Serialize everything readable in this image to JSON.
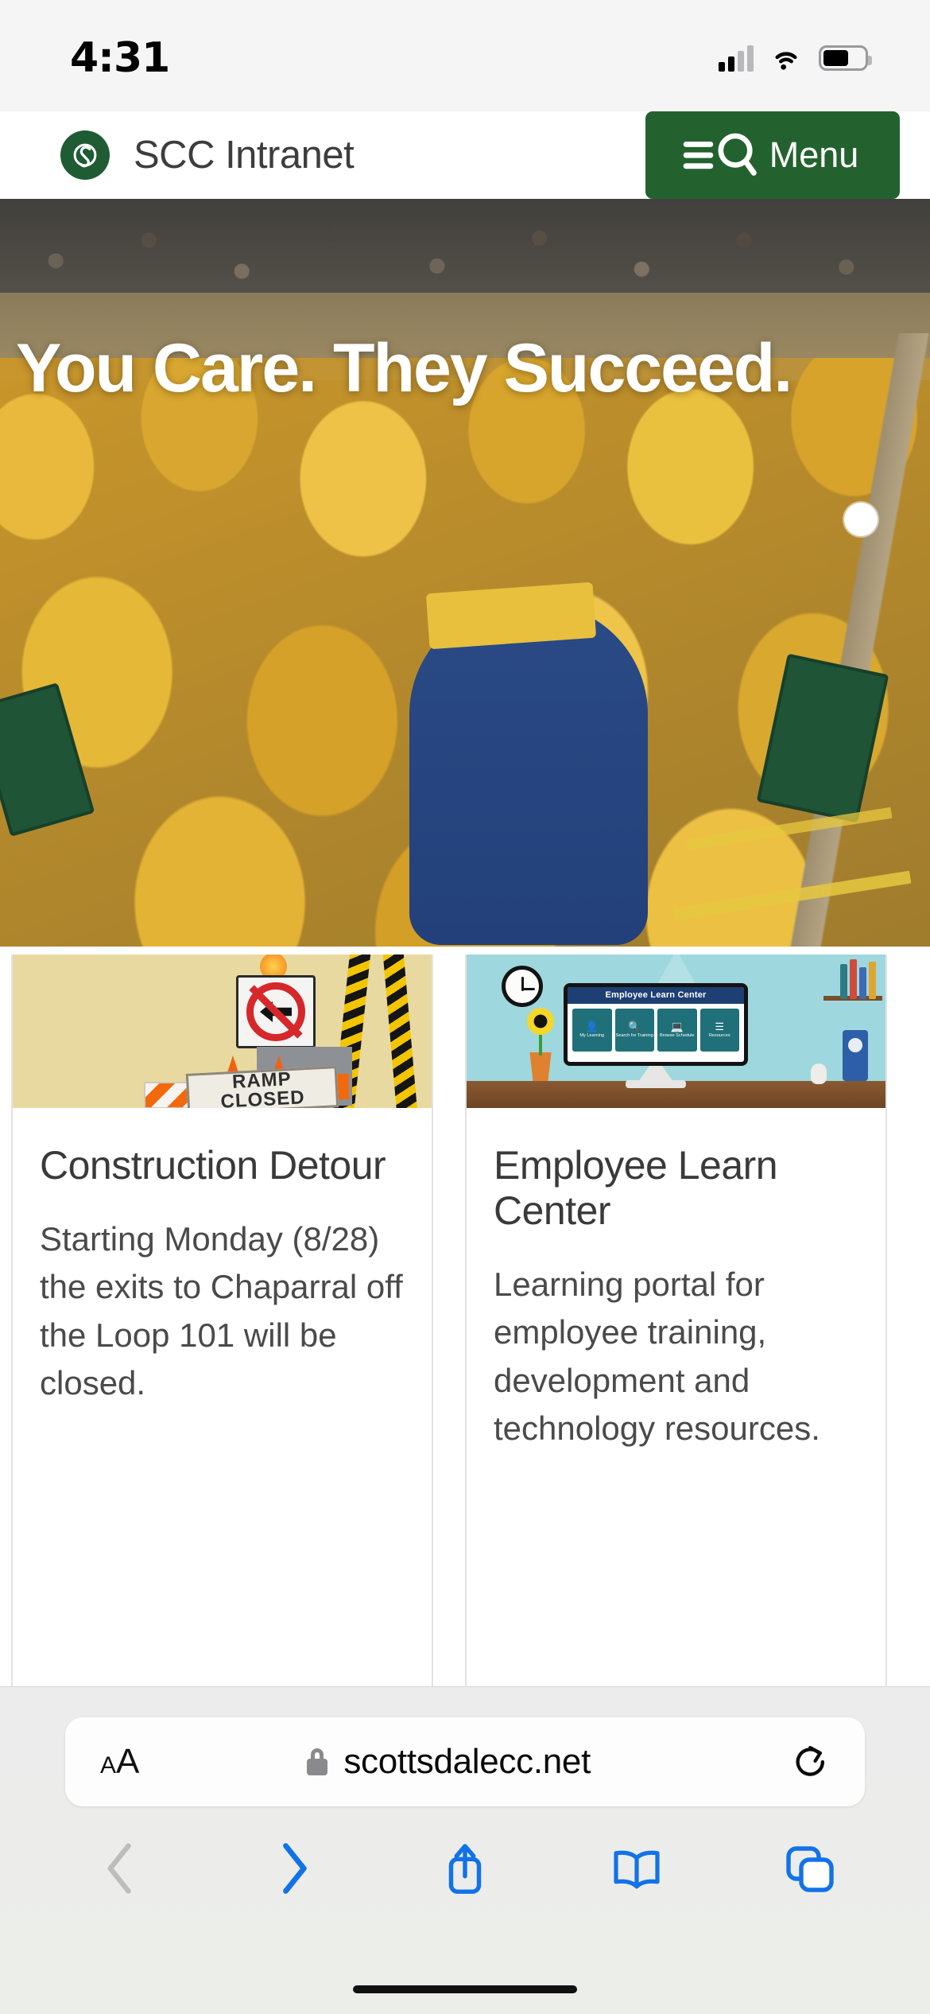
{
  "status_bar": {
    "time": "4:31",
    "icons": [
      "cellular-signal-icon",
      "wifi-icon",
      "battery-icon"
    ]
  },
  "site_header": {
    "logo_icon": "scc-s-logo-icon",
    "brand_name": "SCC Intranet",
    "menu_button": {
      "label": "Menu",
      "icons": [
        "hamburger-icon",
        "search-icon"
      ],
      "background": "#23622f"
    }
  },
  "hero": {
    "headline": "You Care. They Succeed.",
    "image_alt": "graduation-photo",
    "carousel_dot_active": true
  },
  "cards": [
    {
      "image_name": "construction-detour-image",
      "image_texts": [
        "RAMP",
        "CLOSED"
      ],
      "title": "Construction Detour",
      "text": "Starting Monday (8/28) the exits to Chaparral off the Loop 101 will be closed."
    },
    {
      "image_name": "employee-learn-center-image",
      "screen_title": "Employee Learn Center",
      "screen_tiles": [
        {
          "icon": "person-badge-icon",
          "label": "My Learning"
        },
        {
          "icon": "magnifier-icon",
          "label": "Search for Training"
        },
        {
          "icon": "monitor-icon",
          "label": "Browse Schedule"
        },
        {
          "icon": "list-icon",
          "label": "Resources"
        }
      ],
      "title": "Employee Learn Center",
      "text": "Learning portal for employee training, development and technology resources."
    }
  ],
  "safari": {
    "text_size_button": "AA",
    "secure_icon": "lock-icon",
    "url": "scottsdalecc.net",
    "reload_icon": "reload-icon",
    "toolbar": [
      {
        "icon": "back-chevron-icon",
        "enabled": false
      },
      {
        "icon": "forward-chevron-icon",
        "enabled": true
      },
      {
        "icon": "share-icon",
        "enabled": true
      },
      {
        "icon": "bookmarks-book-icon",
        "enabled": true
      },
      {
        "icon": "tabs-icon",
        "enabled": true
      }
    ],
    "accent_color": "#1272e8",
    "disabled_color": "#bdbdbd"
  }
}
